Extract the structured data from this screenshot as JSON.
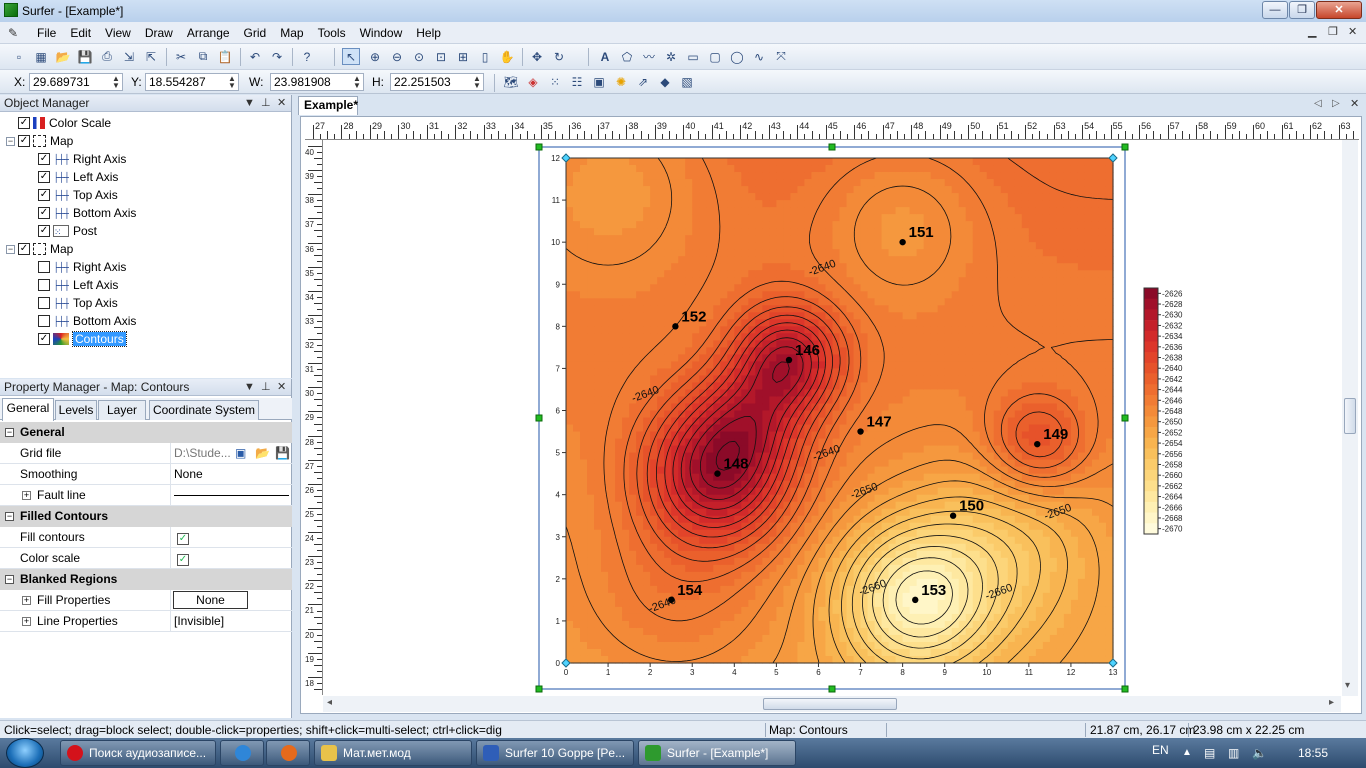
{
  "window": {
    "title": "Surfer - [Example*]",
    "min": "—",
    "max": "❐",
    "close": "✕"
  },
  "menu": {
    "items": [
      "File",
      "Edit",
      "View",
      "Draw",
      "Arrange",
      "Grid",
      "Map",
      "Tools",
      "Window",
      "Help"
    ]
  },
  "coords": {
    "x_label": "X:",
    "x_value": "29.689731",
    "y_label": "Y:",
    "y_value": "18.554287",
    "w_label": "W:",
    "w_value": "23.981908",
    "h_label": "H:",
    "h_value": "22.251503"
  },
  "object_manager": {
    "title": "Object Manager",
    "items": [
      {
        "label": "Color Scale",
        "checked": true,
        "level": 0
      },
      {
        "label": "Map",
        "checked": true,
        "level": 0
      },
      {
        "label": "Right Axis",
        "checked": true,
        "level": 1
      },
      {
        "label": "Left Axis",
        "checked": true,
        "level": 1
      },
      {
        "label": "Top Axis",
        "checked": true,
        "level": 1
      },
      {
        "label": "Bottom Axis",
        "checked": true,
        "level": 1
      },
      {
        "label": "Post",
        "checked": true,
        "level": 1
      },
      {
        "label": "Map",
        "checked": true,
        "level": 0
      },
      {
        "label": "Right Axis",
        "checked": false,
        "level": 1
      },
      {
        "label": "Left Axis",
        "checked": false,
        "level": 1
      },
      {
        "label": "Top Axis",
        "checked": false,
        "level": 1
      },
      {
        "label": "Bottom Axis",
        "checked": false,
        "level": 1
      },
      {
        "label": "Contours",
        "checked": true,
        "level": 1,
        "selected": true
      }
    ]
  },
  "property_manager": {
    "title": "Property Manager - Map: Contours",
    "tabs": [
      "General",
      "Levels",
      "Layer",
      "Coordinate System"
    ],
    "sections": {
      "general": "General",
      "grid_file_label": "Grid file",
      "grid_file_value": "D:\\Stude...",
      "smoothing_label": "Smoothing",
      "smoothing_value": "None",
      "fault_line_label": "Fault line",
      "filled_contours": "Filled Contours",
      "fill_contours_label": "Fill contours",
      "color_scale_label": "Color scale",
      "blanked_regions": "Blanked Regions",
      "fill_properties_label": "Fill Properties",
      "fill_properties_value": "None",
      "line_properties_label": "Line Properties",
      "line_properties_value": "[Invisible]"
    }
  },
  "document": {
    "tab": "Example*"
  },
  "ruler": {
    "top_ticks": [
      "27",
      "28",
      "29",
      "30",
      "31",
      "32",
      "33",
      "34",
      "35",
      "36",
      "37",
      "38",
      "39",
      "40",
      "41",
      "42",
      "43",
      "44",
      "45",
      "46",
      "47",
      "48",
      "49",
      "50",
      "51",
      "52",
      "53",
      "54",
      "55",
      "56",
      "57",
      "58",
      "59",
      "60",
      "61",
      "62",
      "63"
    ],
    "left_ticks": [
      "40",
      "39",
      "38",
      "37",
      "36",
      "35",
      "34",
      "33",
      "32",
      "31",
      "30",
      "29",
      "28",
      "27",
      "26",
      "25",
      "24",
      "23",
      "22",
      "21",
      "20",
      "19",
      "18"
    ]
  },
  "map": {
    "x_ticks": [
      "0",
      "1",
      "2",
      "3",
      "4",
      "5",
      "6",
      "7",
      "8",
      "9",
      "10",
      "11",
      "12",
      "13"
    ],
    "y_ticks": [
      "0",
      "1",
      "2",
      "3",
      "4",
      "5",
      "6",
      "7",
      "8",
      "9",
      "10",
      "11",
      "12"
    ],
    "posts": [
      {
        "label": "151",
        "x": 8.0,
        "y": 10.0
      },
      {
        "label": "152",
        "x": 2.6,
        "y": 8.0
      },
      {
        "label": "146",
        "x": 5.3,
        "y": 7.2
      },
      {
        "label": "147",
        "x": 7.0,
        "y": 5.5
      },
      {
        "label": "149",
        "x": 11.2,
        "y": 5.2
      },
      {
        "label": "148",
        "x": 3.6,
        "y": 4.5
      },
      {
        "label": "150",
        "x": 9.2,
        "y": 3.5
      },
      {
        "label": "153",
        "x": 8.3,
        "y": 1.5
      },
      {
        "label": "154",
        "x": 2.5,
        "y": 1.5
      }
    ],
    "contour_labels": [
      {
        "text": "-2640",
        "x": 5.8,
        "y": 9.2
      },
      {
        "text": "-2640",
        "x": 1.6,
        "y": 6.2
      },
      {
        "text": "-2640",
        "x": 5.9,
        "y": 4.8
      },
      {
        "text": "-2650",
        "x": 6.8,
        "y": 3.9
      },
      {
        "text": "-2650",
        "x": 11.4,
        "y": 3.4
      },
      {
        "text": "-2660",
        "x": 7.0,
        "y": 1.6
      },
      {
        "text": "-2660",
        "x": 10.0,
        "y": 1.5
      },
      {
        "text": "-2640",
        "x": 2.0,
        "y": 1.2
      }
    ],
    "color_scale": [
      "-2626",
      "-2628",
      "-2630",
      "-2632",
      "-2634",
      "-2636",
      "-2638",
      "-2640",
      "-2642",
      "-2644",
      "-2646",
      "-2648",
      "-2650",
      "-2652",
      "-2654",
      "-2656",
      "-2658",
      "-2660",
      "-2662",
      "-2664",
      "-2666",
      "-2668",
      "-2670"
    ],
    "scale_colors": [
      "#8b0a28",
      "#a0102a",
      "#b3182a",
      "#c4202a",
      "#d22a2a",
      "#dc362a",
      "#e2442a",
      "#e6522a",
      "#ea602c",
      "#ee6e30",
      "#f17c34",
      "#f38a38",
      "#f5983e",
      "#f7a646",
      "#f8b450",
      "#f9c05c",
      "#fbcb6a",
      "#fcd57a",
      "#fddf8c",
      "#fee8a0",
      "#fef0b4",
      "#fff6c8",
      "#fffbdc"
    ]
  },
  "statusbar": {
    "hint": "Click=select; drag=block select; double-click=properties; shift+click=multi-select; ctrl+click=dig",
    "object": "Map: Contours",
    "position": "21.87 cm, 26.17 cm",
    "size": "23.98 cm x 22.25 cm"
  },
  "taskbar": {
    "tasks": [
      "Поиск аудиозаписе...",
      "",
      "",
      "Мат.мет.мод",
      "Surfer 10 Goppe [Pe...",
      "Surfer - [Example*]"
    ],
    "lang": "EN",
    "time": "18:55"
  }
}
